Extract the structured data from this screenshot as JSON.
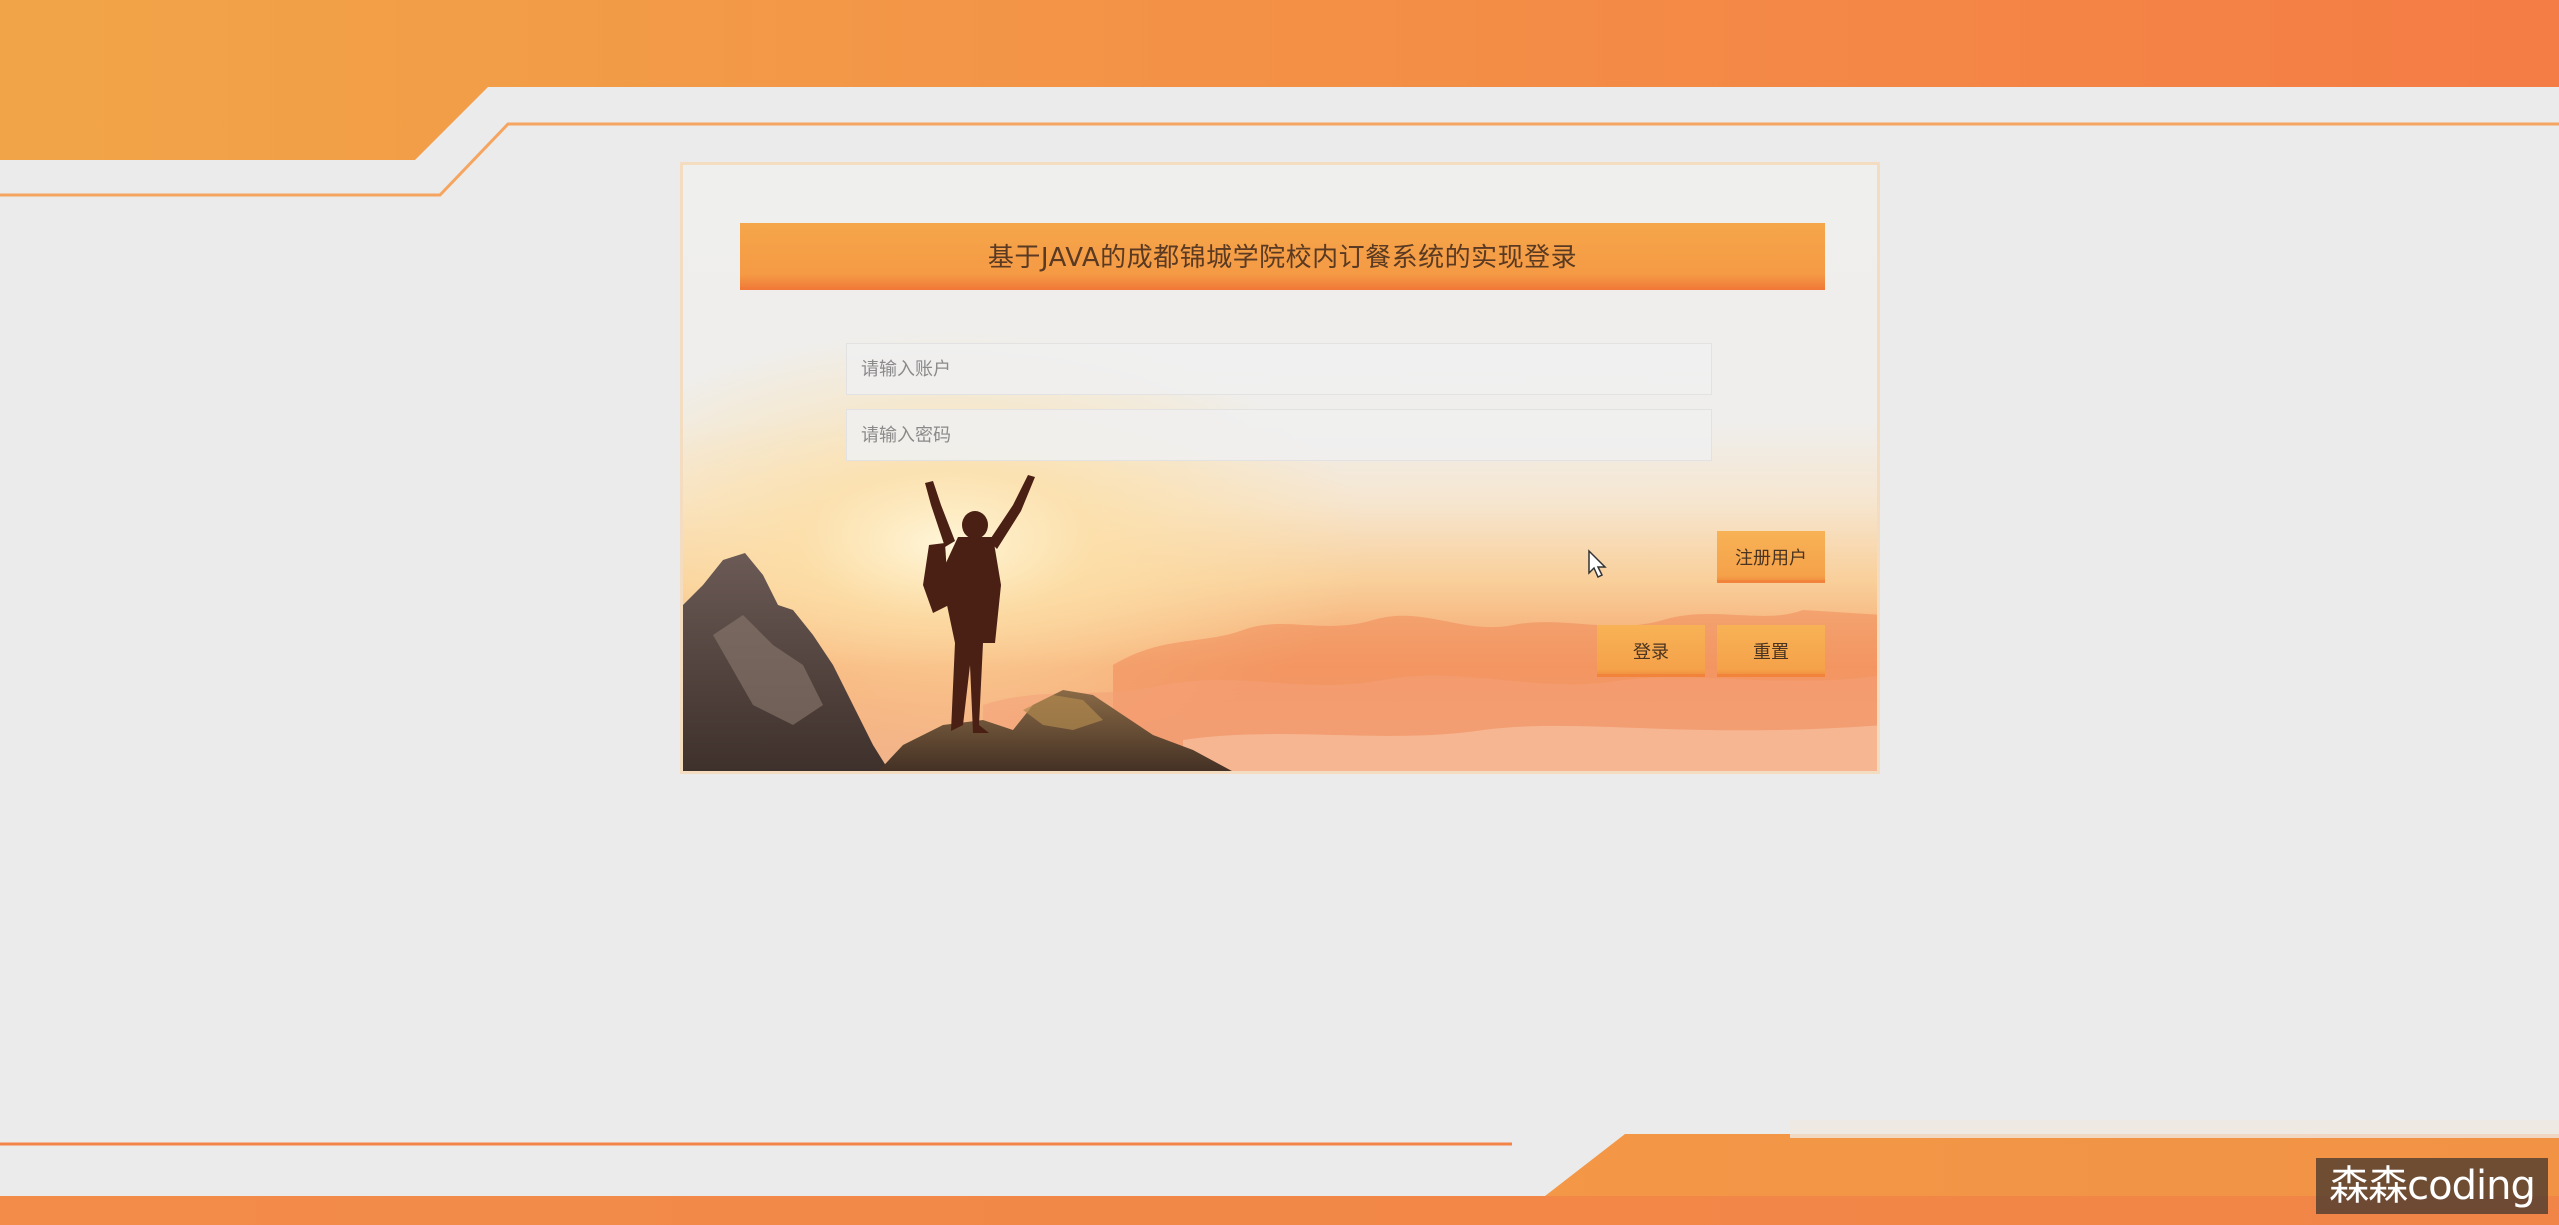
{
  "login": {
    "title": "基于JAVA的成都锦城学院校内订餐系统的实现登录",
    "account_placeholder": "请输入账户",
    "password_placeholder": "请输入密码",
    "register_label": "注册用户",
    "login_label": "登录",
    "reset_label": "重置"
  },
  "watermark": {
    "text": "森森coding"
  },
  "colors": {
    "accent_orange": "#f5a24a",
    "accent_deep": "#f27a38",
    "background": "#ebebeb"
  },
  "icons": [
    "mouse-cursor-icon"
  ]
}
